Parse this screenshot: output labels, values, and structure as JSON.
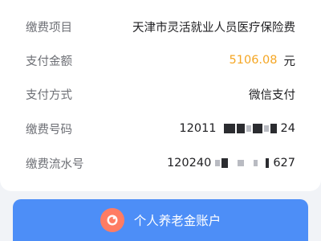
{
  "details": {
    "item_label": "缴费项目",
    "item_value": "天津市灵活就业人员医疗保险费",
    "amount_label": "支付金额",
    "amount_value": "5106.08",
    "amount_unit": "元",
    "method_label": "支付方式",
    "method_value": "微信支付",
    "number_label": "缴费号码",
    "number_prefix": "12011",
    "number_suffix": "24",
    "serial_label": "缴费流水号",
    "serial_prefix": "120240",
    "serial_suffix": "627"
  },
  "actions": {
    "pension_button_label": "个人养老金账户",
    "pension_button_icon": "coin-piggy-icon"
  },
  "colors": {
    "amount": "#f5a623",
    "button": "#4d8ef7",
    "button_icon_bg": "#ff7c63"
  }
}
